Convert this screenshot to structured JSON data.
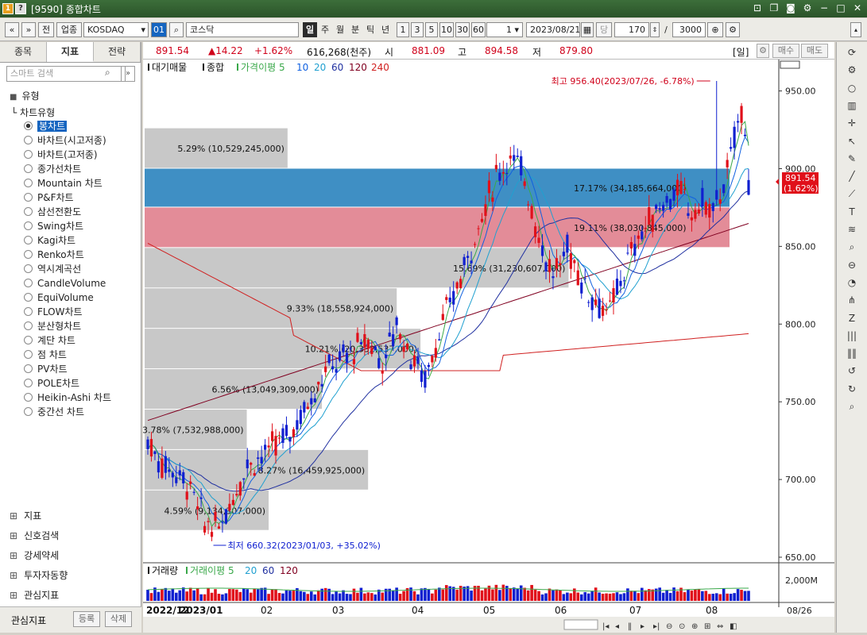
{
  "window": {
    "title": "[9590] 종합차트",
    "logo_text": "1",
    "help_text": "?"
  },
  "toolbar": {
    "prev": "«",
    "next": "»",
    "jeon": "전",
    "sector": "업종",
    "market": "KOSDAQ",
    "code_btn": "01",
    "name": "코스닥",
    "periods": [
      "일",
      "주",
      "월",
      "분",
      "틱",
      "년"
    ],
    "intervals": [
      "1",
      "3",
      "5",
      "10",
      "30",
      "60"
    ],
    "unit": "1",
    "date": "2023/08/21",
    "dang": "당",
    "count": "170",
    "slash": "/",
    "total": "3000"
  },
  "left": {
    "tabs": [
      "종목",
      "지표",
      "전략"
    ],
    "search_placeholder": "스마트 검색",
    "section": "유형",
    "tree_root": "차트유형",
    "chart_types": [
      "봉차트",
      "바차트(시고저종)",
      "바차트(고저종)",
      "종가선차트",
      "Mountain 차트",
      "P&F차트",
      "삼선전환도",
      "Swing차트",
      "Kagi차트",
      "Renko차트",
      "역시계곡선",
      "CandleVolume",
      "EquiVolume",
      "FLOW차트",
      "분산형차트",
      "계단 차트",
      "점 차트",
      "PV차트",
      "POLE차트",
      "Heikin-Ashi 차트",
      "중간선 차트"
    ],
    "sections": [
      "지표",
      "신호검색",
      "강세약세",
      "투자자동향",
      "관심지표"
    ],
    "bottom_title": "관심지표",
    "register": "등록",
    "delete": "삭제"
  },
  "info": {
    "price": "891.54",
    "change": "▲14.22",
    "pct": "+1.62%",
    "volume": "616,268(천주)",
    "open_label": "시",
    "open": "881.09",
    "high_label": "고",
    "high": "894.58",
    "low_label": "저",
    "low": "879.80",
    "period_btn": "[일]",
    "buy": "매수",
    "sell": "매도"
  },
  "legend": {
    "price": [
      "대기매물",
      "종합",
      "가격이평 5",
      "10",
      "20",
      "60",
      "120",
      "240"
    ],
    "volume": [
      "거래량",
      "거래이평 5",
      "20",
      "60",
      "120"
    ]
  },
  "colors": {
    "up": "#e0101a",
    "down": "#1020d0",
    "ma5": "#3aa84a",
    "ma10": "#1060e0",
    "ma20": "#20a0d0",
    "ma60": "#2030a0",
    "ma120": "#800020",
    "ma240": "#d02020"
  },
  "annotations": {
    "high": "최고 956.40(2023/07/26, -6.78%)",
    "low": "최저 660.32(2023/01/03, +35.02%)"
  },
  "current_label": {
    "price": "891.54",
    "pct": "(1.62%)"
  },
  "volume_axis_label": "2,000M",
  "date_label": "08/26",
  "chart_data": {
    "type": "candlestick",
    "x_labels": [
      "2022/12",
      "2023/01",
      "02",
      "03",
      "04",
      "05",
      "06",
      "07",
      "08"
    ],
    "ylim": [
      650,
      960
    ],
    "y_ticks": [
      "650.00",
      "700.00",
      "750.00",
      "800.00",
      "850.00",
      "900.00",
      "950.00"
    ],
    "volume_ylim": [
      0,
      2000
    ],
    "volume_profile": [
      {
        "label": "5.29% (10,529,245,000)",
        "lo": 900,
        "hi": 926
      },
      {
        "label": "17.17% (34,185,664,000)",
        "lo": 875,
        "hi": 900,
        "highlight": "blue"
      },
      {
        "label": "19.11% (38,030,845,000)",
        "lo": 849,
        "hi": 875,
        "highlight": "red"
      },
      {
        "label": "15.69% (31,230,607,000)",
        "lo": 823,
        "hi": 849
      },
      {
        "label": "9.33% (18,558,924,000)",
        "lo": 797,
        "hi": 823
      },
      {
        "label": "10.21% (20,332,537,000)",
        "lo": 771,
        "hi": 797
      },
      {
        "label": "6.56% (13,049,309,000)",
        "lo": 745,
        "hi": 771
      },
      {
        "label": "3.78% (7,532,988,000)",
        "lo": 719,
        "hi": 745
      },
      {
        "label": "8.27% (16,459,925,000)",
        "lo": 693,
        "hi": 719
      },
      {
        "label": "4.59% (9,134,307,000)",
        "lo": 667,
        "hi": 693
      }
    ]
  }
}
